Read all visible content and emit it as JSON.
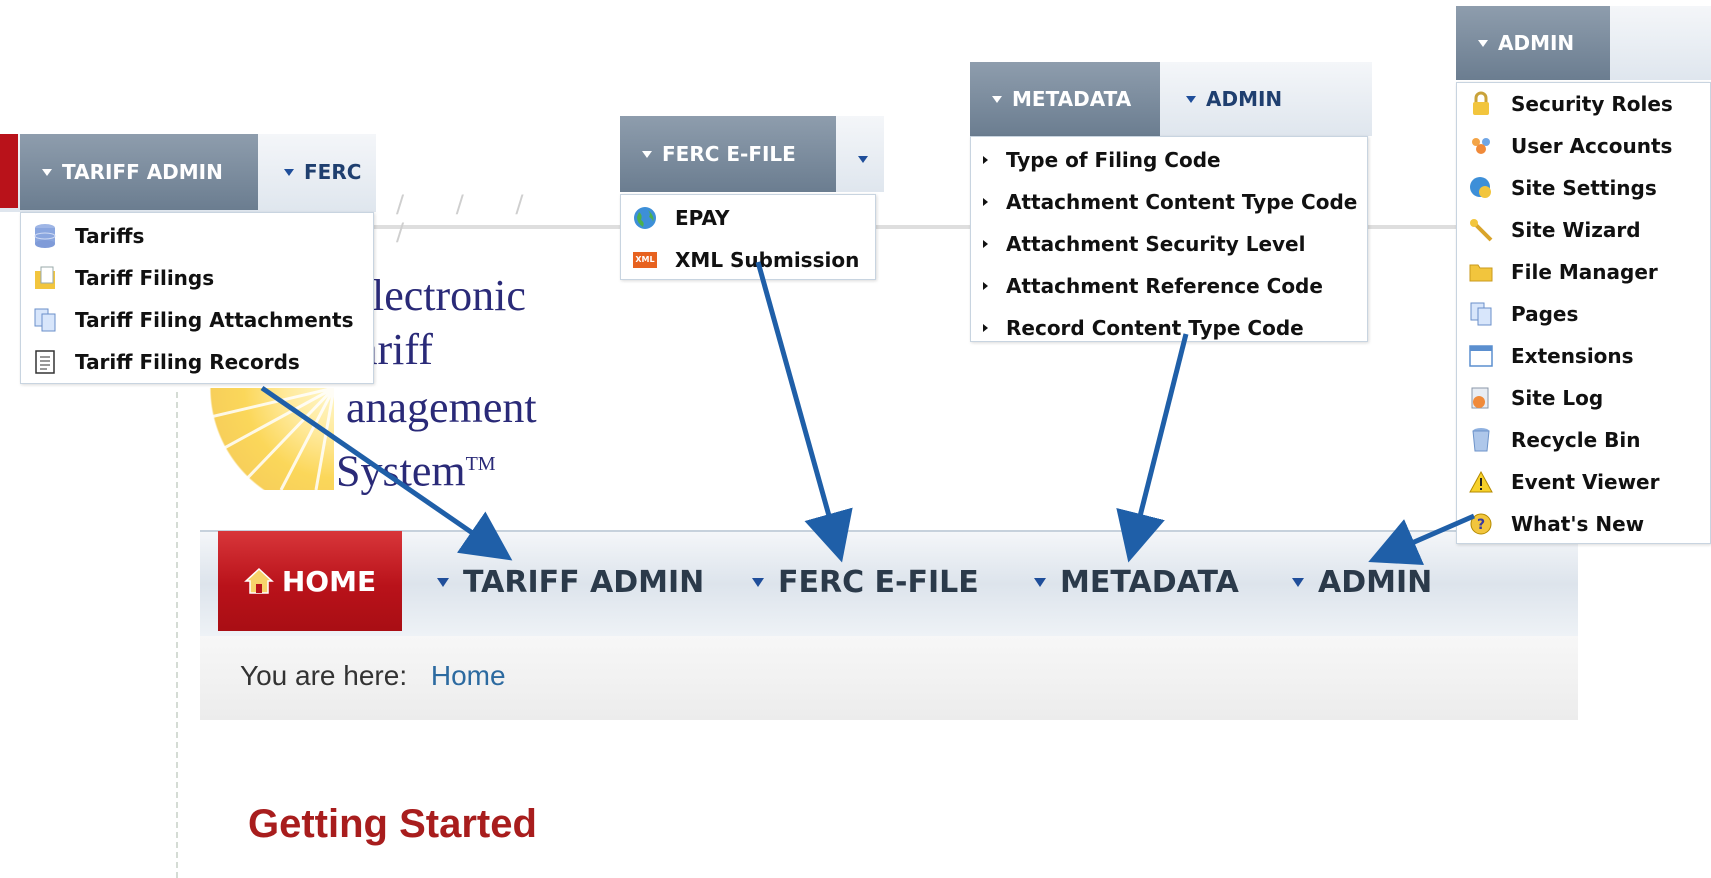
{
  "logo": {
    "line1": "lectronic",
    "line2": "ariff",
    "line3": "anagement",
    "line4": "System",
    "tm": "TM"
  },
  "nav": {
    "home": "HOME",
    "tariff_admin": "TARIFF ADMIN",
    "ferc_efile": "FERC E-FILE",
    "metadata": "METADATA",
    "admin": "ADMIN"
  },
  "breadcrumb": {
    "prefix": "You are here:",
    "link": "Home"
  },
  "main": {
    "heading": "Getting Started"
  },
  "popup_tariff": {
    "tab_active": "TARIFF ADMIN",
    "tab_next": "FERC",
    "items": [
      {
        "label": "Tariffs",
        "icon": "database-icon"
      },
      {
        "label": "Tariff Filings",
        "icon": "folder-files-icon"
      },
      {
        "label": "Tariff Filing Attachments",
        "icon": "documents-icon"
      },
      {
        "label": "Tariff Filing Records",
        "icon": "document-list-icon"
      }
    ]
  },
  "popup_ferc": {
    "tab_active": "FERC E-FILE",
    "items": [
      {
        "label": "EPAY",
        "icon": "globe-icon"
      },
      {
        "label": "XML Submission",
        "icon": "xml-icon"
      }
    ],
    "xml_badge": "XML"
  },
  "popup_metadata": {
    "tab_active": "METADATA",
    "tab_next": "ADMIN",
    "items": [
      {
        "label": "Type of Filing Code"
      },
      {
        "label": "Attachment Content Type Code"
      },
      {
        "label": "Attachment Security Level"
      },
      {
        "label": "Attachment Reference Code"
      },
      {
        "label": "Record Content Type Code"
      }
    ]
  },
  "popup_admin": {
    "tab_active": "ADMIN",
    "items": [
      {
        "label": "Security Roles",
        "icon": "lock-icon"
      },
      {
        "label": "User Accounts",
        "icon": "users-icon"
      },
      {
        "label": "Site Settings",
        "icon": "globe-settings-icon"
      },
      {
        "label": "Site Wizard",
        "icon": "wand-icon"
      },
      {
        "label": "File Manager",
        "icon": "folder-icon"
      },
      {
        "label": "Pages",
        "icon": "pages-icon"
      },
      {
        "label": "Extensions",
        "icon": "window-icon"
      },
      {
        "label": "Site Log",
        "icon": "log-icon"
      },
      {
        "label": "Recycle Bin",
        "icon": "recycle-bin-icon"
      },
      {
        "label": "Event Viewer",
        "icon": "warning-icon"
      },
      {
        "label": "What's New",
        "icon": "help-icon"
      }
    ]
  },
  "colors": {
    "home_red": "#b9121a",
    "heading_red": "#a81d1d",
    "arrow_blue": "#1f5fa8",
    "nav_text": "#2b3a4a",
    "link_blue": "#2c6aa0"
  }
}
